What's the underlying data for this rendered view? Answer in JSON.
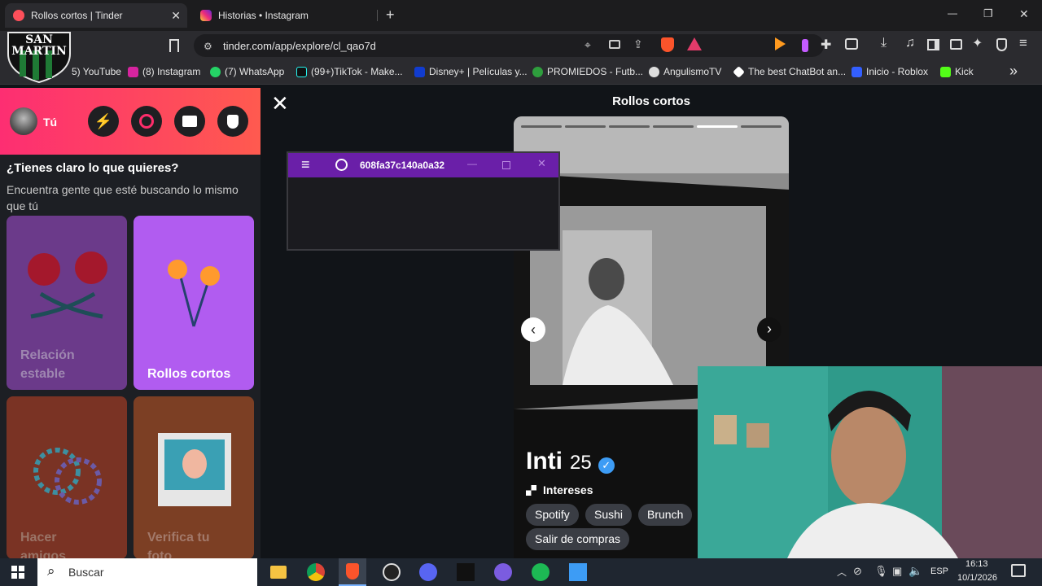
{
  "tabs": [
    {
      "title": "Rollos cortos | Tinder",
      "close": "✕"
    },
    {
      "title": "Historias • Instagram"
    }
  ],
  "new_tab": "+",
  "window_controls": {
    "minimize": "—",
    "maximize": "❐",
    "close": "✕"
  },
  "address": {
    "url": "tinder.com/app/explore/cl_qao7d"
  },
  "logo_text": "SAN MARTIN",
  "bookmarks": [
    {
      "label": "5) YouTube",
      "color": "#ff0000"
    },
    {
      "label": "(8) Instagram",
      "color": "#d6249f"
    },
    {
      "label": "(7) WhatsApp",
      "color": "#25d366"
    },
    {
      "label": "(99+)TikTok - Make...",
      "color": "#000000"
    },
    {
      "label": "Disney+ | Películas y...",
      "color": "#113ccf"
    },
    {
      "label": "PROMIEDOS - Futb...",
      "color": "#2e9e3d"
    },
    {
      "label": "AngulismoTV",
      "color": "#444444"
    },
    {
      "label": "The best ChatBot an...",
      "color": "#ffffff"
    },
    {
      "label": "Inicio - Roblox",
      "color": "#335fff"
    },
    {
      "label": "Kick",
      "color": "#53fc18"
    }
  ],
  "bookmarks_more": "»",
  "sidebar": {
    "user_label": "Tú",
    "heading": "¿Tienes claro lo que quieres?",
    "subheading": "Encuentra gente que esté buscando lo mismo que tú",
    "cards": [
      {
        "label": "Relación estable",
        "bg": "#6b3a8a"
      },
      {
        "label": "Rollos cortos",
        "bg": "#b15cf0"
      },
      {
        "label": "Hacer amigos",
        "bg": "#7a3324"
      },
      {
        "label": "Verifica tu foto",
        "bg": "#7c3f24"
      }
    ]
  },
  "main": {
    "close": "✕",
    "title": "Rollos cortos",
    "photo_progress": {
      "total": 6,
      "current": 5
    }
  },
  "profile": {
    "name": "Inti",
    "age": "25",
    "interests_label": "Intereses",
    "interests": [
      "Spotify",
      "Sushi",
      "Brunch",
      "Salir de compras"
    ]
  },
  "overlay": {
    "title": "608fa37c140a0a32"
  },
  "taskbar": {
    "search_placeholder": "Buscar",
    "language": "ESP",
    "time": "16:13",
    "date": "10/1/2026"
  },
  "colors": {
    "tinder_gradient_start": "#fd2e72",
    "tinder_gradient_end": "#ff5a4f",
    "overlay_purple": "#6a1fa8",
    "verified_blue": "#3d9cf5"
  }
}
